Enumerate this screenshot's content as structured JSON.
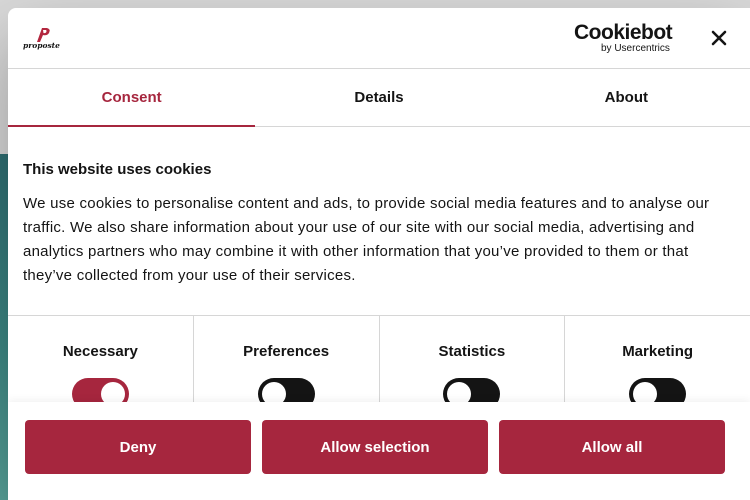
{
  "brand": {
    "accent": "#a6263e",
    "site_logo_text": "proposte",
    "cmp_name": "Cookiebot",
    "cmp_sub": "by Usercentrics"
  },
  "tabs": [
    {
      "label": "Consent",
      "active": true
    },
    {
      "label": "Details",
      "active": false
    },
    {
      "label": "About",
      "active": false
    }
  ],
  "consent": {
    "title": "This website uses cookies",
    "text": "We use cookies to personalise content and ads, to provide social media features and to analyse our traffic. We also share information about your use of our site with our social media, advertising and analytics partners who may combine it with other information that you’ve provided to them or that they’ve collected from your use of their services."
  },
  "categories": [
    {
      "label": "Necessary",
      "enabled": true
    },
    {
      "label": "Preferences",
      "enabled": false
    },
    {
      "label": "Statistics",
      "enabled": false
    },
    {
      "label": "Marketing",
      "enabled": false
    }
  ],
  "buttons": {
    "deny": "Deny",
    "allow_selection": "Allow selection",
    "allow_all": "Allow all"
  },
  "icons": {
    "close": "close-icon",
    "logo": "proposte-logo"
  }
}
